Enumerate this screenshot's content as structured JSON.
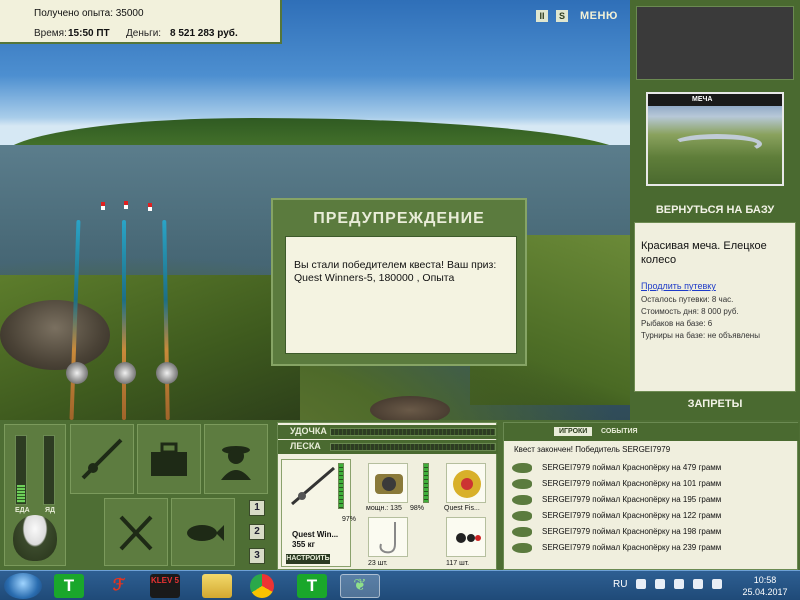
{
  "info": {
    "experience_text": "Получено опыта: 35000",
    "time_label": "Время:",
    "time_value": "15:50 ПТ",
    "money_label": "Деньги:",
    "money_value": "8 521 283 руб."
  },
  "top_icons": {
    "pause": "II",
    "sound": "S",
    "menu_label": "МЕНЮ"
  },
  "right_panel": {
    "photo_caption": "МЕЧА",
    "back_button": "ВЕРНУТЬСЯ НА БАЗУ",
    "base_name": "Красивая меча. Елецкое колесо",
    "extend_link": "Продлить путевку",
    "stats": [
      "Осталось путевки: 8 час.",
      "Стоимость дня: 8 000 руб.",
      "Рыбаков на базе: 6",
      "Турниры на базе: не объявлены"
    ],
    "bans_button": "ЗАПРЕТЫ"
  },
  "dialog": {
    "title": "ПРЕДУПРЕЖДЕНИЕ",
    "message": "Вы стали победителем квеста! Ваш приз: Quest Winners-5, 180000 , Опыта"
  },
  "status_bars": {
    "food_label": "ЕДА",
    "poison_label": "ЯД",
    "food_level": 0.28,
    "poison_level": 0
  },
  "pager": [
    "1",
    "2",
    "3"
  ],
  "tackle": {
    "rod_label": "УДОЧКА",
    "line_label": "ЛЕСКА",
    "rod_name": "Quest Win...",
    "rod_weight": "355 кг",
    "rod_percent": "97%",
    "setup_button": "НАСТРОИТЬ",
    "reel_power": "мощн.: 135",
    "reel_percent": "98%",
    "line_name": "Quest Fis...",
    "hook_count": "23 шт.",
    "bait_count": "117 шт."
  },
  "events": {
    "tab_players": "ИГРОКИ",
    "tab_events": "СОБЫТИЯ",
    "header": "Квест закончен! Победитель SERGEI7979",
    "rows": [
      "SERGEI7979 поймал Краснопёрку на 479 грамм",
      "SERGEI7979 поймал Краснопёрку на 101 грамм",
      "SERGEI7979 поймал Краснопёрку на 195 грамм",
      "SERGEI7979 поймал Краснопёрку на 122 грамм",
      "SERGEI7979 поймал Краснопёрку на 198 грамм",
      "SERGEI7979 поймал Краснопёрку на 239 грамм"
    ]
  },
  "taskbar": {
    "language": "RU",
    "time": "10:58",
    "date": "25.04.2017",
    "t_icon": "T",
    "klev_label": "KLEV 5"
  }
}
